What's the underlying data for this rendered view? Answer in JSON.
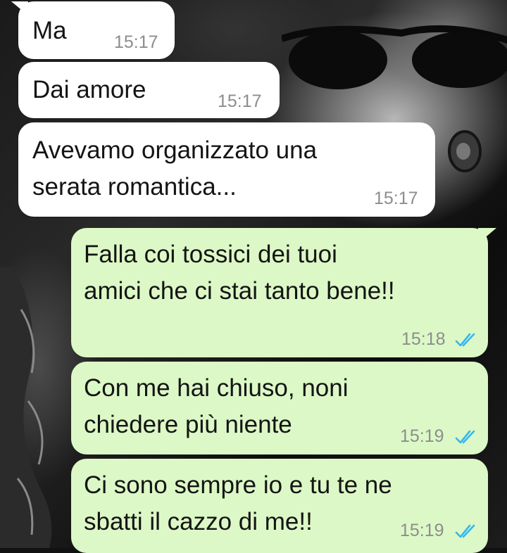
{
  "chat": {
    "wallpaper_icon": "photo-wallpaper",
    "colors": {
      "incoming_bubble": "#ffffff",
      "outgoing_bubble": "#dcf8c6",
      "time_text": "#8d8d8d",
      "read_ticks": "#34b7f1"
    },
    "messages": [
      {
        "direction": "incoming",
        "text": "Ma",
        "time": "15:17"
      },
      {
        "direction": "incoming",
        "text": "Dai amore",
        "time": "15:17"
      },
      {
        "direction": "incoming",
        "text": "Avevamo organizzato una\nserata romantica...",
        "time": "15:17"
      },
      {
        "direction": "outgoing",
        "text": "Falla coi tossici dei tuoi\namici che ci stai tanto bene!!",
        "time": "15:18",
        "status": "read"
      },
      {
        "direction": "outgoing",
        "text": "Con me hai chiuso, noni\nchiedere più niente",
        "time": "15:19",
        "status": "read"
      },
      {
        "direction": "outgoing",
        "text": "Ci sono sempre io e tu te ne\nsbatti il cazzo di me!!",
        "time": "15:19",
        "status": "read"
      }
    ]
  }
}
